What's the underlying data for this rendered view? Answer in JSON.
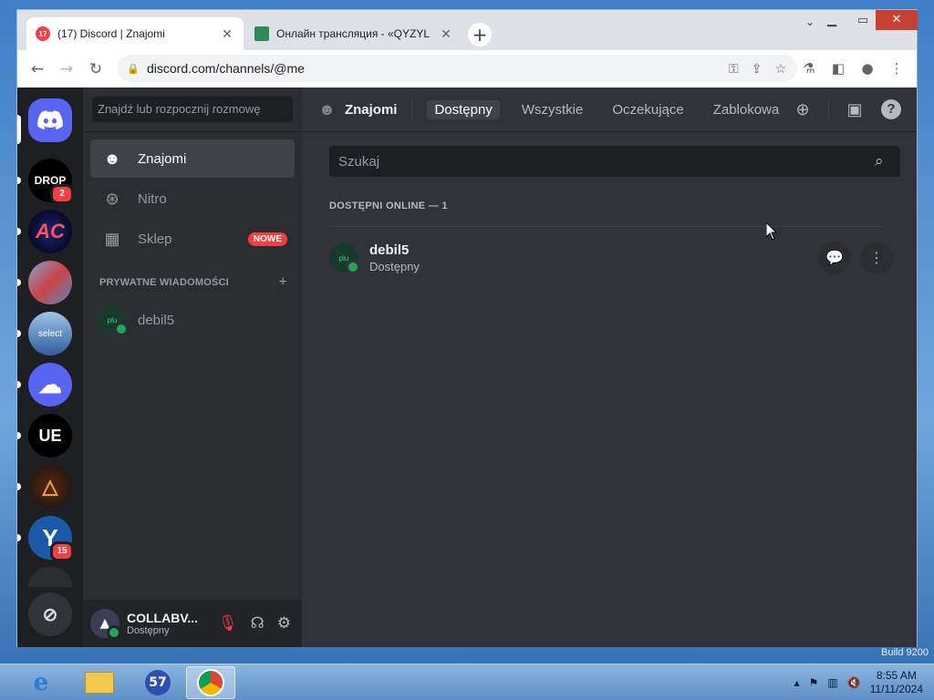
{
  "window": {
    "tabs": [
      {
        "title": "(17) Discord | Znajomi",
        "favicon_badge": "17",
        "active": true
      },
      {
        "title": "Онлайн трансляция - «QYZYL",
        "active": false
      }
    ],
    "address": "discord.com/channels/@me"
  },
  "guilds": {
    "items": [
      {
        "name": "home-discord",
        "label": ""
      },
      {
        "name": "guild-drop",
        "label": "DROP",
        "badge": "2"
      },
      {
        "name": "guild-ac",
        "label": "AC"
      },
      {
        "name": "guild-3",
        "label": ""
      },
      {
        "name": "guild-select",
        "label": "select"
      },
      {
        "name": "guild-cloud",
        "label": ""
      },
      {
        "name": "guild-ue",
        "label": "UE"
      },
      {
        "name": "guild-a",
        "label": ""
      },
      {
        "name": "guild-y",
        "label": "Y",
        "badge": "15"
      }
    ]
  },
  "sidebar": {
    "search_placeholder": "Znajdź lub rozpocznij rozmowę",
    "nav": [
      {
        "label": "Znajomi"
      },
      {
        "label": "Nitro"
      },
      {
        "label": "Sklep",
        "badge": "NOWE"
      }
    ],
    "dm_header": "PRYWATNE WIADOMOŚCI",
    "dm_add": "+",
    "dms": [
      {
        "name": "debil5",
        "avatar_text": "plu"
      }
    ]
  },
  "user": {
    "name": "COLLABV...",
    "status": "Dostępny"
  },
  "main": {
    "title": "Znajomi",
    "tabs": [
      {
        "label": "Dostępny",
        "selected": true
      },
      {
        "label": "Wszystkie"
      },
      {
        "label": "Oczekujące"
      },
      {
        "label": "Zablokowa"
      }
    ],
    "search_placeholder": "Szukaj",
    "online_header": "DOSTĘPNI ONLINE — 1",
    "friends": [
      {
        "name": "debil5",
        "status": "Dostępny",
        "avatar_text": "plu"
      }
    ]
  },
  "taskbar": {
    "time": "8:55 AM",
    "date": "11/11/2024",
    "badge": "57"
  },
  "desktop": {
    "watermark": "Build 9200"
  },
  "colors": {
    "blurple": "#5865f2",
    "online": "#23a55a",
    "red": "#f23f43"
  }
}
